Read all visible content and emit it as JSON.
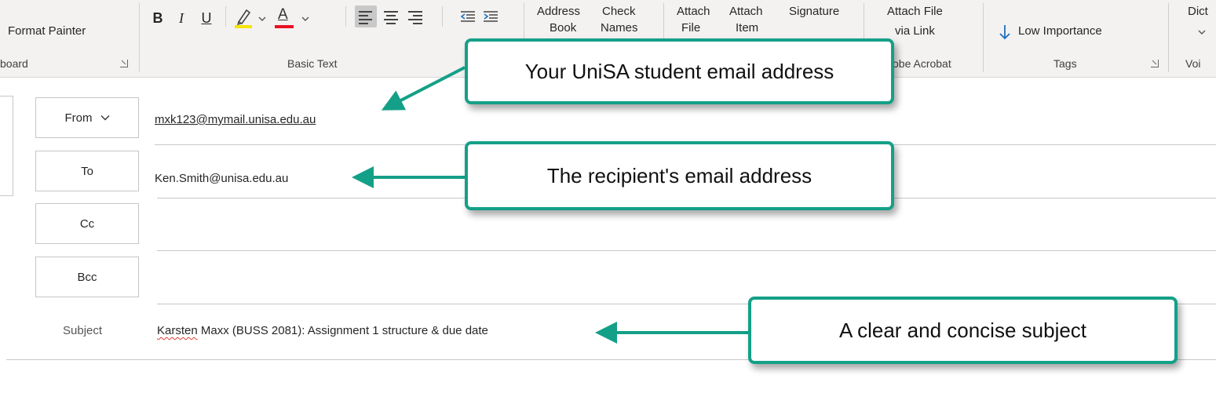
{
  "ribbon": {
    "clipboard": {
      "format_painter": "Format Painter",
      "group_label": "board"
    },
    "basic_text": {
      "bold": "B",
      "italic": "I",
      "underline": "U",
      "font_color_letter": "A",
      "group_label": "Basic Text",
      "highlight_color": "#f5e400",
      "font_color": "#e81123"
    },
    "names": {
      "address_book_top": "Address",
      "address_book_bottom": "Book",
      "check_names_top": "Check",
      "check_names_bottom": "Names"
    },
    "include": {
      "attach_file_top": "Attach",
      "attach_file_bottom": "File",
      "attach_item_top": "Attach",
      "attach_item_bottom": "Item",
      "signature_top": "Signature"
    },
    "adobe": {
      "attach_link_top": "Attach File",
      "attach_link_bottom": "via Link",
      "group_label": "obe Acrobat"
    },
    "tags": {
      "low_importance": "Low Importance",
      "group_label": "Tags"
    },
    "voice": {
      "dictate": "Dict",
      "group_label": "Voi"
    }
  },
  "header": {
    "from_label": "From",
    "from_value": "mxk123@mymail.unisa.edu.au",
    "to_label": "To",
    "to_value": "Ken.Smith@unisa.edu.au",
    "cc_label": "Cc",
    "bcc_label": "Bcc",
    "subject_label": "Subject",
    "subject_first_word": "Karsten",
    "subject_rest": " Maxx (BUSS 2081): Assignment 1 structure & due date"
  },
  "callouts": {
    "from": "Your UniSA student email address",
    "to": "The recipient's email address",
    "subject": "A clear and concise subject"
  },
  "colors": {
    "callout_border": "#14a088",
    "arrow": "#14a088",
    "ribbon_bg": "#f3f2f1"
  }
}
